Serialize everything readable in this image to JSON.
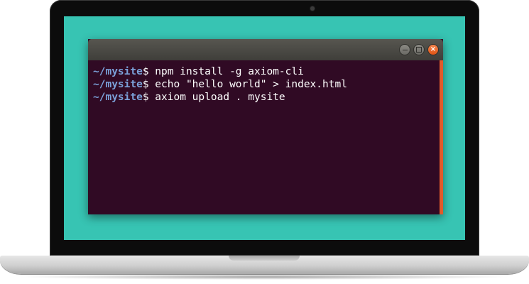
{
  "terminal": {
    "window_controls": {
      "minimize_icon": "minimize-icon",
      "maximize_icon": "maximize-icon",
      "close_icon": "close-icon",
      "close_glyph": "×"
    },
    "lines": [
      {
        "path": "~/mysite",
        "symbol": "$",
        "command": " npm install -g axiom-cli"
      },
      {
        "path": "~/mysite",
        "symbol": "$",
        "command": " echo \"hello world\" > index.html"
      },
      {
        "path": "~/mysite",
        "symbol": "$",
        "command": " axiom upload . mysite"
      }
    ]
  },
  "colors": {
    "screen_background": "#37c4b3",
    "terminal_background": "#300a24",
    "prompt_path": "#7ba1d9",
    "close_button": "#e05314",
    "scrollbar": "#e05a2a"
  }
}
